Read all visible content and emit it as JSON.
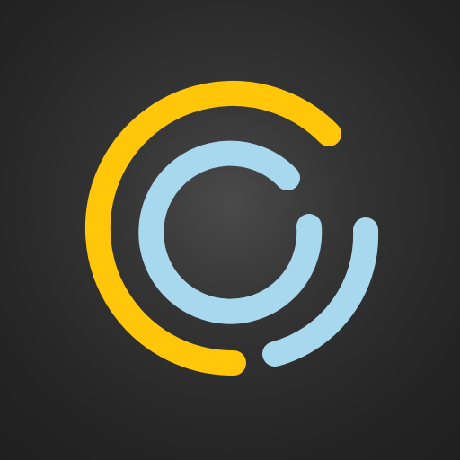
{
  "logo": {
    "name": "concentric-arcs-logo",
    "colors": {
      "background": "#2b2b2b",
      "outer_arc": "#FFC60A",
      "inner_arcs": "#A8D8EE"
    }
  }
}
